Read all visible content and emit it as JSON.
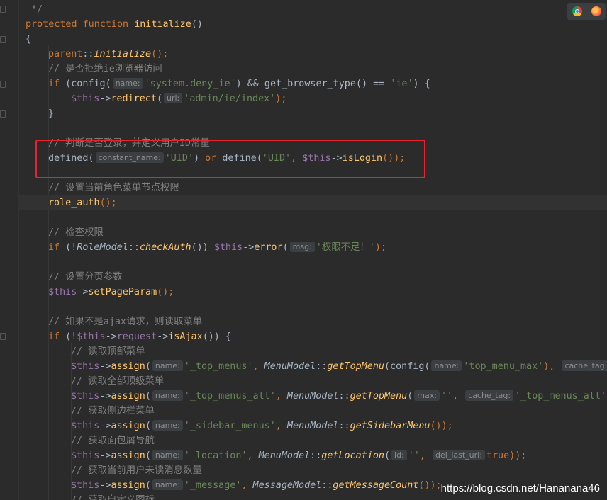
{
  "window": {
    "browser_icons": [
      "chrome-icon",
      "firefox-icon"
    ]
  },
  "watermark": "https://blog.csdn.net/Hananana46",
  "colors": {
    "keyword": "#cc7832",
    "function": "#ffc66d",
    "string": "#6a8759",
    "variable": "#9876aa",
    "comment": "#808080",
    "highlight_box": "#e8232d",
    "background": "#2b2b2b"
  },
  "code": {
    "l0_comment_end": "*/",
    "l1_protected": "protected",
    "l1_function": "function",
    "l1_name": "initialize",
    "l1_parens": "()",
    "l2_brace": "{",
    "l3_parent": "parent",
    "l3_sep": "::",
    "l3_call": "initialize",
    "l3_end": "();",
    "l4_comment": "// 是否拒绝ie浏览器访问",
    "l5_if": "if",
    "l5_a": " (config(",
    "l5_hint": "name:",
    "l5_str1": "'system.deny_ie'",
    "l5_b": ") && get_browser_type() == ",
    "l5_str2": "'ie'",
    "l5_c": ") {",
    "l6_this": "$this",
    "l6_arrow": "->",
    "l6_fn": "redirect",
    "l6_open": "(",
    "l6_hint": "url:",
    "l6_str": "'admin/ie/index'",
    "l6_end": ");",
    "l7_brace": "}",
    "l8_comment": "// 判断是否登录，并定义用户ID常量",
    "l9_defined": "defined(",
    "l9_hint": "constant_name:",
    "l9_str1": "'UID'",
    "l9_a": ") ",
    "l9_or": "or",
    "l9_b": " define(",
    "l9_str2": "'UID'",
    "l9_c": ", ",
    "l9_this": "$this",
    "l9_arrow": "->",
    "l9_fn": "isLogin",
    "l9_end": "());",
    "l10_comment": "// 设置当前角色菜单节点权限",
    "l11_fn": "role_auth",
    "l11_end": "();",
    "l12_comment": "// 检查权限",
    "l13_if": "if",
    "l13_a": " (!",
    "l13_cls": "RoleModel",
    "l13_sep": "::",
    "l13_fn": "checkAuth",
    "l13_b": "()) ",
    "l13_this": "$this",
    "l13_arrow": "->",
    "l13_call": "error",
    "l13_open": "(",
    "l13_hint": "msg:",
    "l13_str": "'权限不足！'",
    "l13_end": ");",
    "l14_comment": "// 设置分页参数",
    "l15_this": "$this",
    "l15_arrow": "->",
    "l15_fn": "setPageParam",
    "l15_end": "();",
    "l16_comment": "// 如果不是ajax请求，则读取菜单",
    "l17_if": "if",
    "l17_a": " (!",
    "l17_this": "$this",
    "l17_arrow1": "->",
    "l17_req": "request",
    "l17_arrow2": "->",
    "l17_fn": "isAjax",
    "l17_end": "()) {",
    "l18_comment": "// 读取顶部菜单",
    "l19_this": "$this",
    "l19_arrow": "->",
    "l19_fn": "assign",
    "l19_open": "(",
    "l19_hint1": "name:",
    "l19_str1": "'_top_menus'",
    "l19_a": ", ",
    "l19_cls": "MenuModel",
    "l19_sep": "::",
    "l19_call": "getTopMenu",
    "l19_b": "(config(",
    "l19_hint2": "name:",
    "l19_str2": "'top_menu_max'",
    "l19_c": "),",
    "l19_hint3": "cache_tag:",
    "l20_comment": "// 读取全部顶级菜单",
    "l21_this": "$this",
    "l21_arrow": "->",
    "l21_fn": "assign",
    "l21_open": "(",
    "l21_hint1": "name:",
    "l21_str1": "'_top_menus_all'",
    "l21_a": ", ",
    "l21_cls": "MenuModel",
    "l21_sep": "::",
    "l21_call": "getTopMenu",
    "l21_open2": "(",
    "l21_hint2": "max:",
    "l21_str2": "''",
    "l21_b": ",",
    "l21_hint3": "cache_tag:",
    "l21_str3": "'_top_menus_all'",
    "l22_comment": "// 获取侧边栏菜单",
    "l23_this": "$this",
    "l23_arrow": "->",
    "l23_fn": "assign",
    "l23_open": "(",
    "l23_hint": "name:",
    "l23_str": "'_sidebar_menus'",
    "l23_a": ", ",
    "l23_cls": "MenuModel",
    "l23_sep": "::",
    "l23_call": "getSidebarMenu",
    "l23_end": "());",
    "l24_comment": "// 获取面包屑导航",
    "l25_this": "$this",
    "l25_arrow": "->",
    "l25_fn": "assign",
    "l25_open": "(",
    "l25_hint1": "name:",
    "l25_str1": "'_location'",
    "l25_a": ", ",
    "l25_cls": "MenuModel",
    "l25_sep": "::",
    "l25_call": "getLocation",
    "l25_open2": "(",
    "l25_hint2": "id:",
    "l25_str2": "''",
    "l25_b": ",",
    "l25_hint3": "del_last_url:",
    "l25_true": "true",
    "l25_end": "));",
    "l26_comment": "// 获取当前用户未读消息数量",
    "l27_this": "$this",
    "l27_arrow": "->",
    "l27_fn": "assign",
    "l27_open": "(",
    "l27_hint": "name:",
    "l27_str": "'_message'",
    "l27_a": ", ",
    "l27_cls": "MessageModel",
    "l27_sep": "::",
    "l27_call": "getMessageCount",
    "l27_end": "());",
    "l28_comment": "// 获取自定义图标"
  }
}
